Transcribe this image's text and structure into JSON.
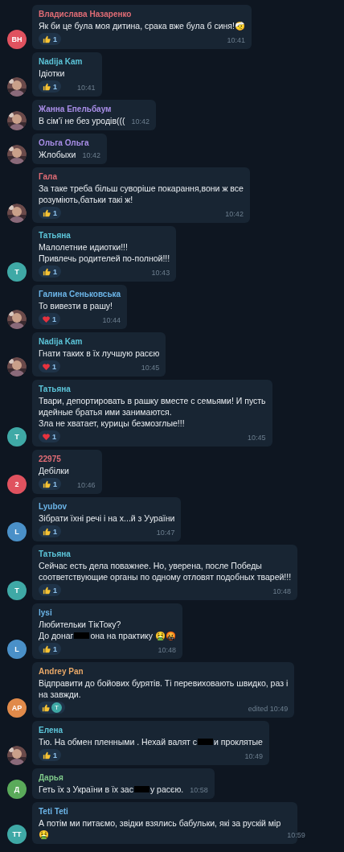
{
  "messages": [
    {
      "author": "Владислава Назаренко",
      "color": "#e06c75",
      "avatar": {
        "kind": "initials",
        "text": "ВН",
        "color": "#e0525f"
      },
      "lines": [
        [
          {
            "kind": "text",
            "text": "Як би це була моя дитина, срака вже була б синя!🤕"
          }
        ]
      ],
      "reactions": [
        {
          "kind": "like",
          "count": "1"
        }
      ],
      "time": "10:41"
    },
    {
      "author": "Nadija Kam",
      "color": "#5cc5d9",
      "avatar": {
        "kind": "picture"
      },
      "lines": [
        [
          {
            "kind": "text",
            "text": "Ідіотки"
          }
        ]
      ],
      "reactions": [
        {
          "kind": "like",
          "count": "1"
        }
      ],
      "time": "10:41"
    },
    {
      "author": "Жанна Епельбаум",
      "color": "#a98ee8",
      "avatar": {
        "kind": "picture"
      },
      "lines": [
        [
          {
            "kind": "text",
            "text": "В сім'ї не без уродів((("
          }
        ]
      ],
      "time": "10:42"
    },
    {
      "author": "Ольга Ольга",
      "color": "#a98ee8",
      "avatar": {
        "kind": "picture"
      },
      "lines": [
        [
          {
            "kind": "text",
            "text": "Жлобыхи"
          }
        ]
      ],
      "time": "10:42"
    },
    {
      "author": "Гала",
      "color": "#e06c75",
      "avatar": {
        "kind": "picture"
      },
      "lines": [
        [
          {
            "kind": "text",
            "text": "За таке треба більш суворіше покарання,вони ж все"
          }
        ],
        [
          {
            "kind": "text",
            "text": "розуміють,батьки такі ж!"
          }
        ]
      ],
      "reactions": [
        {
          "kind": "like",
          "count": "1"
        }
      ],
      "time": "10:42"
    },
    {
      "author": "Татьяна",
      "color": "#5cc5d9",
      "avatar": {
        "kind": "initials",
        "text": "Т",
        "color": "#3fa9a6"
      },
      "lines": [
        [
          {
            "kind": "text",
            "text": "Малолетние идиотки!!!"
          }
        ],
        [
          {
            "kind": "text",
            "text": "Привлечь родителей по-полной!!!"
          }
        ]
      ],
      "reactions": [
        {
          "kind": "like",
          "count": "1"
        }
      ],
      "time": "10:43"
    },
    {
      "author": "Галина Сеньковська",
      "color": "#6cb5e8",
      "avatar": {
        "kind": "picture"
      },
      "lines": [
        [
          {
            "kind": "text",
            "text": "То вивезти в рашу!"
          }
        ]
      ],
      "reactions": [
        {
          "kind": "heart",
          "count": "1"
        }
      ],
      "time": "10:44"
    },
    {
      "author": "Nadija Kam",
      "color": "#5cc5d9",
      "avatar": {
        "kind": "picture"
      },
      "lines": [
        [
          {
            "kind": "text",
            "text": "Гнати таких в їх лучшую расєю"
          }
        ]
      ],
      "reactions": [
        {
          "kind": "heart",
          "count": "1"
        }
      ],
      "time": "10:45"
    },
    {
      "author": "Татьяна",
      "color": "#5cc5d9",
      "avatar": {
        "kind": "initials",
        "text": "Т",
        "color": "#3fa9a6"
      },
      "lines": [
        [
          {
            "kind": "text",
            "text": "Твари, депортировать в рашку вместе с семьями! И пусть"
          }
        ],
        [
          {
            "kind": "text",
            "text": "идейные братья ими занимаются."
          }
        ],
        [
          {
            "kind": "text",
            "text": "Зла не хватает, курицы безмозглые!!!"
          }
        ]
      ],
      "reactions": [
        {
          "kind": "heart",
          "count": "1"
        }
      ],
      "time": "10:45"
    },
    {
      "author": "22975",
      "color": "#e06c75",
      "avatar": {
        "kind": "initials",
        "text": "2",
        "color": "#e0525f"
      },
      "lines": [
        [
          {
            "kind": "text",
            "text": "Дебілки"
          }
        ]
      ],
      "reactions": [
        {
          "kind": "like",
          "count": "1"
        }
      ],
      "time": "10:46"
    },
    {
      "author": "Lyubov",
      "color": "#6cb5e8",
      "avatar": {
        "kind": "initials",
        "text": "L",
        "color": "#4a90c8"
      },
      "lines": [
        [
          {
            "kind": "text",
            "text": "Зібрати їхні речі і на х...й з Уураїни"
          }
        ]
      ],
      "reactions": [
        {
          "kind": "like",
          "count": "1"
        }
      ],
      "time": "10:47"
    },
    {
      "author": "Татьяна",
      "color": "#5cc5d9",
      "avatar": {
        "kind": "initials",
        "text": "Т",
        "color": "#3fa9a6"
      },
      "lines": [
        [
          {
            "kind": "text",
            "text": "Сейчас есть дела поважнее. Но, уверена, после Победы"
          }
        ],
        [
          {
            "kind": "text",
            "text": "соответствующие органы по одному отловят подобных тварей!!!"
          }
        ]
      ],
      "reactions": [
        {
          "kind": "like",
          "count": "1"
        }
      ],
      "time": "10:48"
    },
    {
      "author": "lysi",
      "color": "#6cb5e8",
      "avatar": {
        "kind": "initials",
        "text": "L",
        "color": "#4a90c8"
      },
      "lines": [
        [
          {
            "kind": "text",
            "text": "Любительки ТікТоку?"
          }
        ],
        [
          {
            "kind": "text",
            "text": "До донаг"
          },
          {
            "kind": "redaction"
          },
          {
            "kind": "text",
            "text": "она на практику 🤮🤬"
          }
        ]
      ],
      "reactions": [
        {
          "kind": "like",
          "count": "1"
        }
      ],
      "time": "10:48"
    },
    {
      "author": "Andrey Pan",
      "color": "#e8a868",
      "avatar": {
        "kind": "initials",
        "text": "AP",
        "color": "#e08a4a"
      },
      "lines": [
        [
          {
            "kind": "text",
            "text": "Відправити до бойових бурятів. Ті перевиховають швидко, раз і"
          }
        ],
        [
          {
            "kind": "text",
            "text": "на завжди."
          }
        ]
      ],
      "reactions": [
        {
          "kind": "like_by",
          "count": "T"
        }
      ],
      "time": "edited 10:49"
    },
    {
      "author": "Елена",
      "color": "#5cc5d9",
      "avatar": {
        "kind": "picture"
      },
      "lines": [
        [
          {
            "kind": "text",
            "text": "Тю. На обмен пленными . Нехай валят с"
          },
          {
            "kind": "redaction"
          },
          {
            "kind": "text",
            "text": "и проклятые"
          }
        ]
      ],
      "reactions": [
        {
          "kind": "like",
          "count": "1"
        }
      ],
      "time": "10:49"
    },
    {
      "author": "Дарья",
      "color": "#7fc98a",
      "avatar": {
        "kind": "initials",
        "text": "Д",
        "color": "#5aaa5a"
      },
      "lines": [
        [
          {
            "kind": "text",
            "text": "Геть їх з України в їх зас"
          },
          {
            "kind": "redaction"
          },
          {
            "kind": "text",
            "text": "у расєю."
          }
        ]
      ],
      "time": "10:58"
    },
    {
      "author": "Teti Teti",
      "color": "#6cb5e8",
      "avatar": {
        "kind": "initials",
        "text": "ТТ",
        "color": "#3fa9a6"
      },
      "lines": [
        [
          {
            "kind": "text",
            "text": "А потім ми питаємо, звідки взялись бабульки, які за рускій мір"
          }
        ],
        [
          {
            "kind": "text",
            "text": "🤮"
          }
        ]
      ],
      "time": "10:59"
    }
  ]
}
